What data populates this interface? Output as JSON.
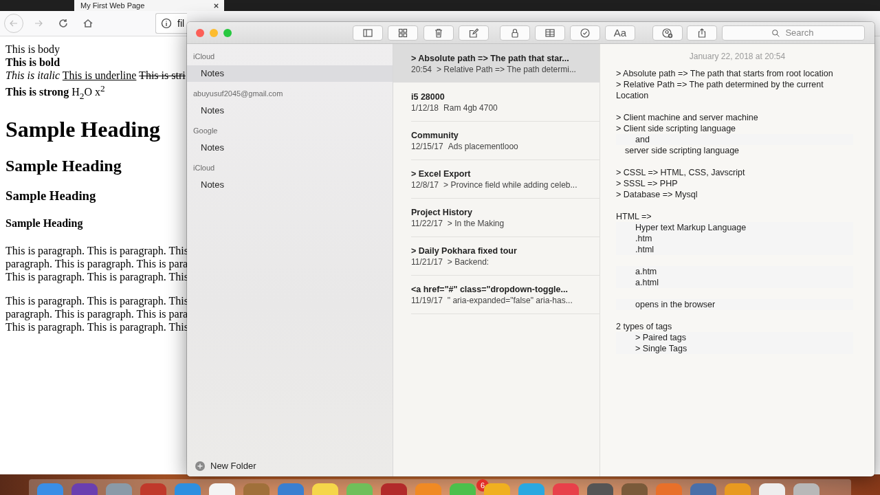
{
  "browser": {
    "tab": {
      "title": "My First Web Page"
    },
    "address": {
      "value": "fil"
    },
    "page": {
      "lines": [
        {
          "kind": "plain",
          "text": "This is body"
        },
        {
          "kind": "bold",
          "text": "This is bold"
        },
        {
          "kind": "mixed",
          "parts": [
            {
              "kind": "italic",
              "text": "This is italic"
            },
            {
              "kind": "underline",
              "text": "This is underline"
            },
            {
              "kind": "strike",
              "text": "This is stri"
            }
          ]
        },
        {
          "kind": "rich",
          "text": "**This is strong** H$_{2}$O x$^{2}$"
        }
      ],
      "headings": [
        {
          "kind": "h1",
          "text": "Sample Heading"
        },
        {
          "kind": "h2",
          "text": "Sample Heading"
        },
        {
          "kind": "h3",
          "text": "Sample Heading"
        },
        {
          "kind": "h4",
          "text": "Sample Heading"
        }
      ],
      "paragraphs": [
        {
          "lines": [
            "This is paragraph. This is paragraph. This",
            "paragraph. This is paragraph. This is para",
            "This is paragraph. This is paragraph. This"
          ]
        },
        {
          "lines": [
            "This is paragraph. This is paragraph. This",
            "paragraph. This is paragraph. This is para",
            "This is paragraph. This is paragraph. This"
          ]
        }
      ]
    }
  },
  "notes_app": {
    "toolbar": {
      "format_label": "Aa",
      "search": {
        "placeholder": "Search"
      }
    },
    "sidebar": {
      "accounts": [
        {
          "name": "iCloud",
          "folders": [
            {
              "name": "Notes",
              "selected": true
            }
          ]
        },
        {
          "name": "abuyusuf2045@gmail.com",
          "folders": [
            {
              "name": "Notes",
              "selected": false
            }
          ]
        },
        {
          "name": "Google",
          "folders": [
            {
              "name": "Notes",
              "selected": false
            }
          ]
        },
        {
          "name": "iCloud",
          "folders": [
            {
              "name": "Notes",
              "selected": false
            }
          ]
        }
      ],
      "new_folder": "New Folder"
    },
    "notes": [
      {
        "title": "> Absolute path => The path that star...",
        "date": "20:54",
        "preview": "> Relative Path => The path determi...",
        "selected": true
      },
      {
        "title": "i5 28000",
        "date": "1/12/18",
        "preview": "Ram 4gb 4700",
        "selected": false
      },
      {
        "title": "Community",
        "date": "12/15/17",
        "preview": "Ads placementlooo",
        "selected": false
      },
      {
        "title": "> Excel Export",
        "date": "12/8/17",
        "preview": "> Province field while adding celeb...",
        "selected": false
      },
      {
        "title": "Project History",
        "date": "11/22/17",
        "preview": "> In the Making",
        "selected": false
      },
      {
        "title": "> Daily Pokhara fixed tour",
        "date": "11/21/17",
        "preview": "> Backend:",
        "selected": false
      },
      {
        "title": "<a href=\"#\" class=\"dropdown-toggle...",
        "date": "11/19/17",
        "preview": "\" aria-expanded=\"false\" aria-has...",
        "selected": false
      }
    ],
    "editor": {
      "date": "January 22, 2018 at 20:54",
      "lines": [
        {
          "kind": "line",
          "text": "> Absolute path => The path that starts from root location"
        },
        {
          "kind": "line",
          "text": "> Relative Path => The path determined by the current Location"
        },
        {
          "kind": "blank"
        },
        {
          "kind": "line",
          "text": "> Client machine and server machine"
        },
        {
          "kind": "line",
          "text": "> Client side scripting language"
        },
        {
          "kind": "tab",
          "text": "and"
        },
        {
          "kind": "space",
          "text": "server side scripting language"
        },
        {
          "kind": "blank"
        },
        {
          "kind": "line",
          "text": "> CSSL => HTML, CSS, Javscript"
        },
        {
          "kind": "line",
          "text": "> SSSL => PHP"
        },
        {
          "kind": "line",
          "text": "> Database => Mysql"
        },
        {
          "kind": "blank"
        },
        {
          "kind": "line",
          "text": "HTML =>"
        },
        {
          "kind": "tab",
          "text": "Hyper text Markup Language"
        },
        {
          "kind": "tab",
          "text": ".htm"
        },
        {
          "kind": "tab",
          "text": ".html"
        },
        {
          "kind": "blank"
        },
        {
          "kind": "tab",
          "text": "a.htm"
        },
        {
          "kind": "tab",
          "text": "a.html"
        },
        {
          "kind": "blank"
        },
        {
          "kind": "tab",
          "text": "opens in the browser"
        },
        {
          "kind": "blank"
        },
        {
          "kind": "line",
          "text": "2 types of tags"
        },
        {
          "kind": "tab",
          "text": "> Paired tags"
        },
        {
          "kind": "tab",
          "text": "> Single Tags"
        }
      ]
    }
  },
  "dock": {
    "badge": "6"
  }
}
